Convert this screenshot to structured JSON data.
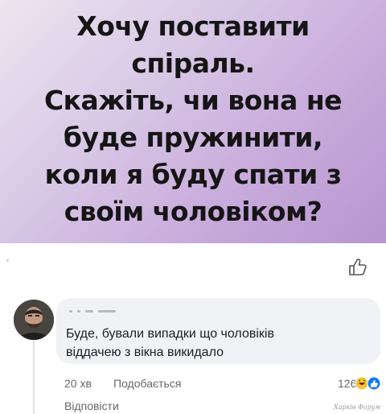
{
  "post": {
    "text": "Хочу поставити\nспіраль.\nСкажіть, чи вона не\nбуде пружинити,\nколи я буду спати з\nсвоїм чоловіком?"
  },
  "comment": {
    "text": "Буде, бували випадки що чоловіків\nвіддачею з вікна викидало",
    "time": "20 хв",
    "like_label": "Подобається",
    "reaction_count": "126",
    "reply_label": "Відповісти"
  },
  "watermark": "Харків Форум",
  "colors": {
    "bubble": "#f0f2f5",
    "like_reaction": "#1877f2",
    "haha_reaction": "#f7c236"
  },
  "icons": {
    "post_like": "thumbs-up-outline-icon",
    "reactions": [
      "haha-reaction-icon",
      "like-reaction-icon"
    ]
  }
}
